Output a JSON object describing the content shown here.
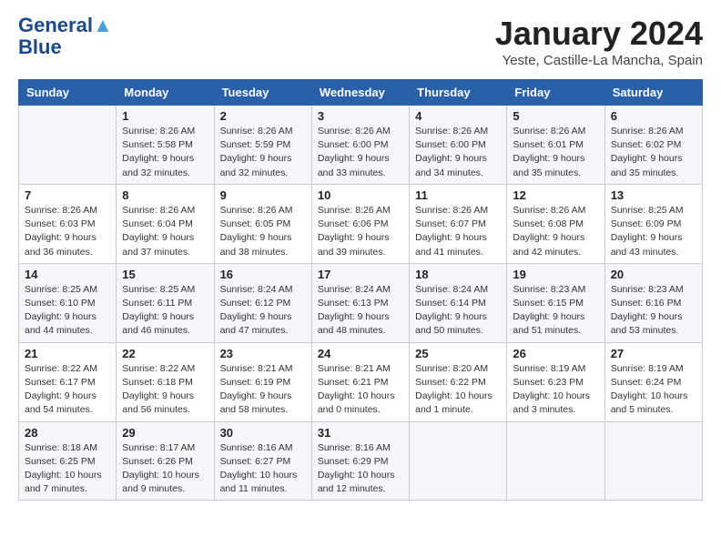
{
  "header": {
    "logo_line1": "General",
    "logo_line2": "Blue",
    "month_title": "January 2024",
    "subtitle": "Yeste, Castille-La Mancha, Spain"
  },
  "columns": [
    "Sunday",
    "Monday",
    "Tuesday",
    "Wednesday",
    "Thursday",
    "Friday",
    "Saturday"
  ],
  "weeks": [
    [
      {
        "day": "",
        "info": ""
      },
      {
        "day": "1",
        "info": "Sunrise: 8:26 AM\nSunset: 5:58 PM\nDaylight: 9 hours\nand 32 minutes."
      },
      {
        "day": "2",
        "info": "Sunrise: 8:26 AM\nSunset: 5:59 PM\nDaylight: 9 hours\nand 32 minutes."
      },
      {
        "day": "3",
        "info": "Sunrise: 8:26 AM\nSunset: 6:00 PM\nDaylight: 9 hours\nand 33 minutes."
      },
      {
        "day": "4",
        "info": "Sunrise: 8:26 AM\nSunset: 6:00 PM\nDaylight: 9 hours\nand 34 minutes."
      },
      {
        "day": "5",
        "info": "Sunrise: 8:26 AM\nSunset: 6:01 PM\nDaylight: 9 hours\nand 35 minutes."
      },
      {
        "day": "6",
        "info": "Sunrise: 8:26 AM\nSunset: 6:02 PM\nDaylight: 9 hours\nand 35 minutes."
      }
    ],
    [
      {
        "day": "7",
        "info": "Sunrise: 8:26 AM\nSunset: 6:03 PM\nDaylight: 9 hours\nand 36 minutes."
      },
      {
        "day": "8",
        "info": "Sunrise: 8:26 AM\nSunset: 6:04 PM\nDaylight: 9 hours\nand 37 minutes."
      },
      {
        "day": "9",
        "info": "Sunrise: 8:26 AM\nSunset: 6:05 PM\nDaylight: 9 hours\nand 38 minutes."
      },
      {
        "day": "10",
        "info": "Sunrise: 8:26 AM\nSunset: 6:06 PM\nDaylight: 9 hours\nand 39 minutes."
      },
      {
        "day": "11",
        "info": "Sunrise: 8:26 AM\nSunset: 6:07 PM\nDaylight: 9 hours\nand 41 minutes."
      },
      {
        "day": "12",
        "info": "Sunrise: 8:26 AM\nSunset: 6:08 PM\nDaylight: 9 hours\nand 42 minutes."
      },
      {
        "day": "13",
        "info": "Sunrise: 8:25 AM\nSunset: 6:09 PM\nDaylight: 9 hours\nand 43 minutes."
      }
    ],
    [
      {
        "day": "14",
        "info": "Sunrise: 8:25 AM\nSunset: 6:10 PM\nDaylight: 9 hours\nand 44 minutes."
      },
      {
        "day": "15",
        "info": "Sunrise: 8:25 AM\nSunset: 6:11 PM\nDaylight: 9 hours\nand 46 minutes."
      },
      {
        "day": "16",
        "info": "Sunrise: 8:24 AM\nSunset: 6:12 PM\nDaylight: 9 hours\nand 47 minutes."
      },
      {
        "day": "17",
        "info": "Sunrise: 8:24 AM\nSunset: 6:13 PM\nDaylight: 9 hours\nand 48 minutes."
      },
      {
        "day": "18",
        "info": "Sunrise: 8:24 AM\nSunset: 6:14 PM\nDaylight: 9 hours\nand 50 minutes."
      },
      {
        "day": "19",
        "info": "Sunrise: 8:23 AM\nSunset: 6:15 PM\nDaylight: 9 hours\nand 51 minutes."
      },
      {
        "day": "20",
        "info": "Sunrise: 8:23 AM\nSunset: 6:16 PM\nDaylight: 9 hours\nand 53 minutes."
      }
    ],
    [
      {
        "day": "21",
        "info": "Sunrise: 8:22 AM\nSunset: 6:17 PM\nDaylight: 9 hours\nand 54 minutes."
      },
      {
        "day": "22",
        "info": "Sunrise: 8:22 AM\nSunset: 6:18 PM\nDaylight: 9 hours\nand 56 minutes."
      },
      {
        "day": "23",
        "info": "Sunrise: 8:21 AM\nSunset: 6:19 PM\nDaylight: 9 hours\nand 58 minutes."
      },
      {
        "day": "24",
        "info": "Sunrise: 8:21 AM\nSunset: 6:21 PM\nDaylight: 10 hours\nand 0 minutes."
      },
      {
        "day": "25",
        "info": "Sunrise: 8:20 AM\nSunset: 6:22 PM\nDaylight: 10 hours\nand 1 minute."
      },
      {
        "day": "26",
        "info": "Sunrise: 8:19 AM\nSunset: 6:23 PM\nDaylight: 10 hours\nand 3 minutes."
      },
      {
        "day": "27",
        "info": "Sunrise: 8:19 AM\nSunset: 6:24 PM\nDaylight: 10 hours\nand 5 minutes."
      }
    ],
    [
      {
        "day": "28",
        "info": "Sunrise: 8:18 AM\nSunset: 6:25 PM\nDaylight: 10 hours\nand 7 minutes."
      },
      {
        "day": "29",
        "info": "Sunrise: 8:17 AM\nSunset: 6:26 PM\nDaylight: 10 hours\nand 9 minutes."
      },
      {
        "day": "30",
        "info": "Sunrise: 8:16 AM\nSunset: 6:27 PM\nDaylight: 10 hours\nand 11 minutes."
      },
      {
        "day": "31",
        "info": "Sunrise: 8:16 AM\nSunset: 6:29 PM\nDaylight: 10 hours\nand 12 minutes."
      },
      {
        "day": "",
        "info": ""
      },
      {
        "day": "",
        "info": ""
      },
      {
        "day": "",
        "info": ""
      }
    ]
  ]
}
